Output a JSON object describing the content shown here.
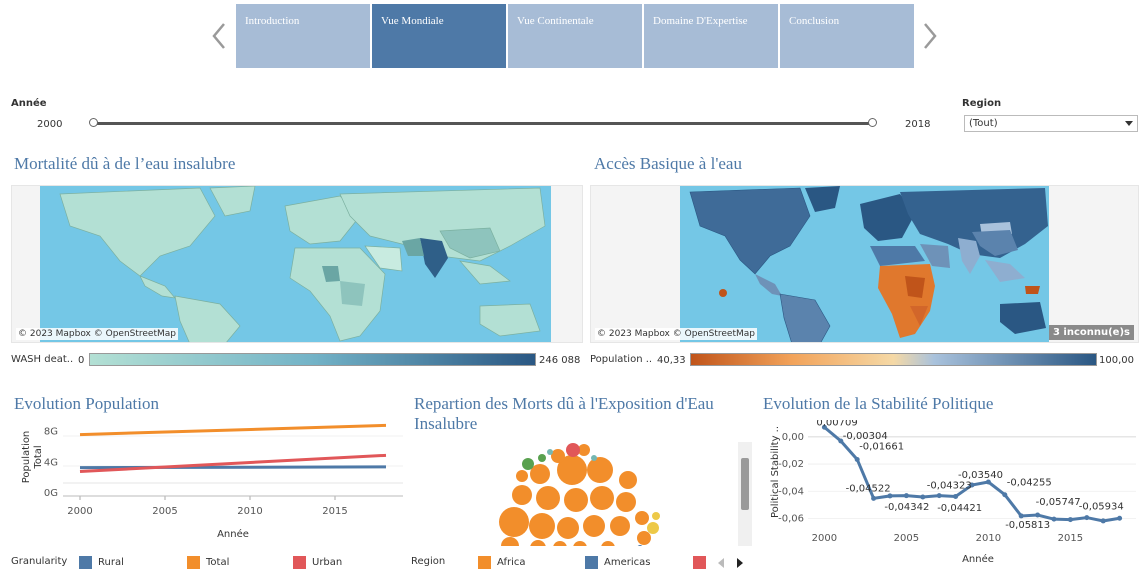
{
  "tabs": [
    {
      "label": "Introduction",
      "active": false
    },
    {
      "label": "Vue Mondiale",
      "active": true
    },
    {
      "label": "Vue Continentale",
      "active": false
    },
    {
      "label": "Domaine D'Expertise",
      "active": false
    },
    {
      "label": "Conclusion",
      "active": false
    }
  ],
  "filters": {
    "year_label": "Année",
    "year_start": "2000",
    "year_end": "2018",
    "region_label": "Region",
    "region_value": "(Tout)"
  },
  "map_left": {
    "title": "Mortalité dû à de l’eau insalubre",
    "credit": "© 2023 Mapbox © OpenStreetMap",
    "legend_label": "WASH deat..",
    "legend_min": "0",
    "legend_max": "246 088",
    "colors": {
      "low": "#b3e0d4",
      "high": "#2a5783"
    }
  },
  "map_right": {
    "title": "Accès Basique à l'eau",
    "credit": "© 2023 Mapbox © OpenStreetMap",
    "unknown_badge": "3 inconnu(e)s",
    "legend_label": "Population ..",
    "legend_min": "40,33",
    "legend_max": "100,00",
    "colors": {
      "low": "#c0541a",
      "mid": "#f5d9a6",
      "high": "#2a5783"
    }
  },
  "population_chart": {
    "title": "Evolution Population",
    "ylabel_1": "Population",
    "ylabel_2": "Total",
    "xlabel": "Année",
    "legend_title": "Granularity",
    "legend": [
      {
        "name": "Rural",
        "color": "#4e79a7"
      },
      {
        "name": "Total",
        "color": "#f28e2b"
      },
      {
        "name": "Urban",
        "color": "#e15759"
      }
    ]
  },
  "bubble_chart": {
    "title": "Repartion des Morts dû à l'Exposition d'Eau Insalubre",
    "legend_title": "Region",
    "legend": [
      {
        "name": "Africa",
        "color": "#f28e2b"
      },
      {
        "name": "Americas",
        "color": "#4e79a7"
      },
      {
        "name": "",
        "color": "#e15759"
      }
    ]
  },
  "stability_chart": {
    "title": "Evolution de la Stabilité Politique",
    "ylabel": "Political Stability ..",
    "xlabel": "Année"
  },
  "chart_data": [
    {
      "type": "line",
      "title": "Evolution Population",
      "xlabel": "Année",
      "ylabel": "Population Total",
      "x": [
        2000,
        2018
      ],
      "xticks": [
        "2000",
        "2005",
        "2010",
        "2015"
      ],
      "yticks": [
        "0G",
        "4G",
        "8G"
      ],
      "ylim": [
        0,
        9.5
      ],
      "xlim": [
        1999,
        2019
      ],
      "series": [
        {
          "name": "Rural",
          "color": "#4e79a7",
          "values": [
            3.3,
            3.4
          ]
        },
        {
          "name": "Total",
          "color": "#f28e2b",
          "values": [
            7.6,
            8.8
          ]
        },
        {
          "name": "Urban",
          "color": "#e15759",
          "values": [
            2.8,
            4.9
          ]
        }
      ]
    },
    {
      "type": "line",
      "title": "Evolution de la Stabilité Politique",
      "xlabel": "Année",
      "ylabel": "Political Stability ..",
      "xticks": [
        "2000",
        "2005",
        "2010",
        "2015"
      ],
      "yticks": [
        "0,00",
        "-0,02",
        "-0,04",
        "-0,06"
      ],
      "xlim": [
        1999,
        2019
      ],
      "ylim": [
        -0.067,
        0.008
      ],
      "series": [
        {
          "name": "",
          "color": "#4e79a7",
          "x": [
            2000,
            2001,
            2002,
            2003,
            2004,
            2005,
            2006,
            2007,
            2008,
            2009,
            2010,
            2011,
            2012,
            2013,
            2014,
            2015,
            2016,
            2017,
            2018
          ],
          "values": [
            0.00709,
            -0.00304,
            -0.01661,
            -0.04522,
            -0.04342,
            -0.04323,
            -0.04421,
            -0.0432,
            -0.0438,
            -0.0354,
            -0.0332,
            -0.04255,
            -0.05813,
            -0.05747,
            -0.0605,
            -0.0608,
            -0.05934,
            -0.0618,
            -0.0598
          ]
        }
      ],
      "labels": [
        {
          "x": 2000,
          "y": 0.00709,
          "text": "0,00709"
        },
        {
          "x": 2001,
          "y": -0.00304,
          "text": "-0,00304"
        },
        {
          "x": 2002,
          "y": -0.01661,
          "text": "-0,01661"
        },
        {
          "x": 2003,
          "y": -0.04522,
          "text": "-0,04522"
        },
        {
          "x": 2005,
          "y": -0.04342,
          "text": "-0,04342"
        },
        {
          "x": 2006,
          "y": -0.04323,
          "text": "-0,04323"
        },
        {
          "x": 2007,
          "y": -0.04421,
          "text": "-0,04421"
        },
        {
          "x": 2009,
          "y": -0.0354,
          "text": "-0,03540"
        },
        {
          "x": 2011,
          "y": -0.04255,
          "text": "-0,04255"
        },
        {
          "x": 2012,
          "y": -0.05813,
          "text": "-0,05813"
        },
        {
          "x": 2013,
          "y": -0.05747,
          "text": "-0,05747"
        },
        {
          "x": 2016,
          "y": -0.05934,
          "text": "-0,05934"
        }
      ]
    }
  ]
}
